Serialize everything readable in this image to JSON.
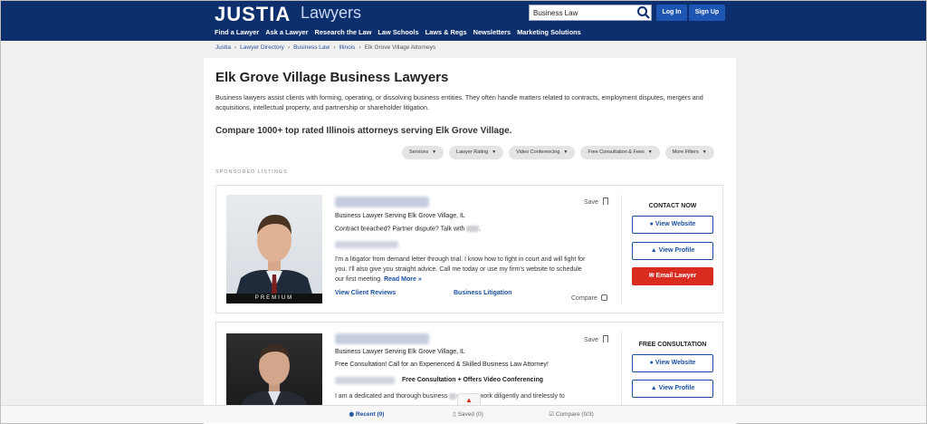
{
  "header": {
    "logo": "JUSTIA",
    "logo_sub": "Lawyers",
    "search_value": "Business Law",
    "login_label": "Log In",
    "signup_label": "Sign Up",
    "nav": [
      "Find a Lawyer",
      "Ask a Lawyer",
      "Research the Law",
      "Law Schools",
      "Laws & Regs",
      "Newsletters",
      "Marketing Solutions"
    ]
  },
  "breadcrumb": [
    "Justia",
    "Lawyer Directory",
    "Business Law",
    "Illinois",
    "Elk Grove Village Attorneys"
  ],
  "page": {
    "title": "Elk Grove Village Business Lawyers",
    "description": "Business lawyers assist clients with forming, operating, or dissolving business entities. They often handle matters related to contracts, employment disputes, mergers and acquisitions, intellectual property, and partnership or shareholder litigation.",
    "compare_heading": "Compare 1000+ top rated Illinois attorneys serving Elk Grove Village.",
    "filters": [
      "Services",
      "Lawyer Rating",
      "Video Conferencing",
      "Free Consultation & Fees",
      "More Filters"
    ],
    "sponsored_label": "SPONSORED LISTINGS"
  },
  "listings": [
    {
      "premium_badge": "PREMIUM",
      "subtitle": "Business Lawyer Serving Elk Grove Village, IL",
      "tagline": "Contract breached? Partner dispute? Talk with",
      "tagline_end": ".",
      "bio": "I'm a litigator from demand letter through trial. I know how to fight in court and will fight for you. I'll also give you straight advice. Call me today or use my firm's website to schedule our first meeting.",
      "read_more": "Read More »",
      "reviews_link": "View Client Reviews",
      "practice_link": "Business Litigation",
      "save_label": "Save",
      "compare_label": "Compare",
      "side_heading": "CONTACT NOW",
      "btn_website": "View Website",
      "btn_profile": "View Profile",
      "btn_email": "Email Lawyer"
    },
    {
      "subtitle": "Business Lawyer Serving Elk Grove Village, IL",
      "tagline": "Free Consultation! Call for an Experienced & Skilled Business Law Attorney!",
      "feature": "Free Consultation + Offers Video Conferencing",
      "bio": "I am a dedicated and thorough business",
      "bio_end": "orney. I work diligently and tirelessly to",
      "save_label": "Save",
      "side_heading": "FREE CONSULTATION",
      "btn_website": "View Website",
      "btn_profile": "View Profile"
    }
  ],
  "bottom_bar": {
    "recent": "Recent (0)",
    "saved": "Saved (0)",
    "compare": "Compare (0/3)"
  },
  "colors": {
    "header_bg": "#0d2f6e",
    "link": "#1a4fa0",
    "email_button": "#d92b20"
  }
}
